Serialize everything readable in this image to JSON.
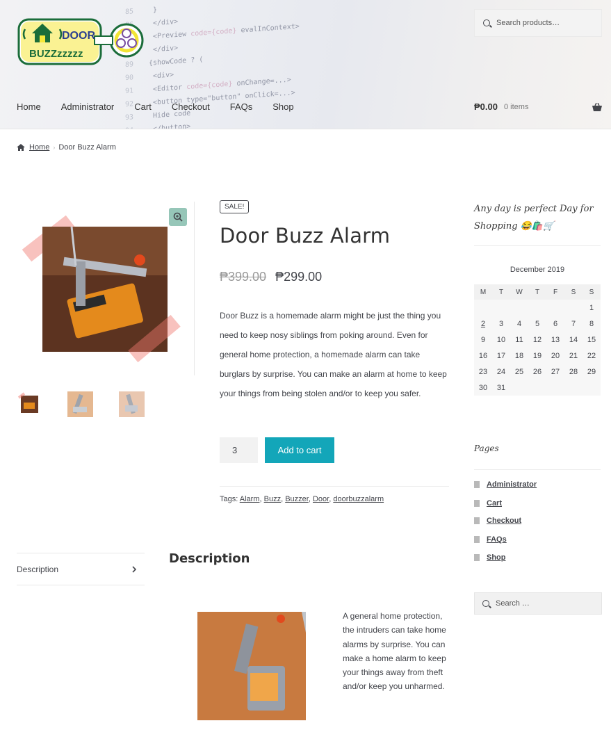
{
  "header": {
    "logo_text_1": "DOOR",
    "logo_text_2": "BUZZzzzzz",
    "search_placeholder": "Search products…",
    "nav": [
      "Home",
      "Administrator",
      "Cart",
      "Checkout",
      "FAQs",
      "Shop"
    ],
    "cart_amount": "₱0.00",
    "cart_items": "0 items"
  },
  "breadcrumb": {
    "home": "Home",
    "current": "Door Buzz Alarm"
  },
  "product": {
    "badge": "SALE!",
    "title": "Door Buzz Alarm",
    "old_price": "₱399.00",
    "new_price": "₱299.00",
    "description": "Door Buzz is a homemade alarm might be just the thing you need to keep nosy siblings from poking around. Even for general home protection, a homemade alarm can take burglars by surprise. You can make an alarm at home to keep your things from being stolen and/or to keep you safer.",
    "quantity": "3",
    "add_to_cart": "Add to cart",
    "tags_label": "Tags:",
    "tags": [
      "Alarm",
      "Buzz",
      "Buzzer",
      "Door",
      "doorbuzzalarm"
    ]
  },
  "tabs": {
    "items": [
      "Description"
    ],
    "heading": "Description",
    "body": "A general home protection, the intruders can take home alarms by surprise. You can make a home alarm to keep your things away from theft and/or keep you unharmed."
  },
  "sidebar": {
    "tagline": "Any day is perfect Day for Shopping 😂🛍️🛒",
    "calendar": {
      "caption": "December 2019",
      "weekdays": [
        "M",
        "T",
        "W",
        "T",
        "F",
        "S",
        "S"
      ],
      "weeks": [
        [
          "",
          "",
          "",
          "",
          "",
          "",
          "1"
        ],
        [
          "2",
          "3",
          "4",
          "5",
          "6",
          "7",
          "8"
        ],
        [
          "9",
          "10",
          "11",
          "12",
          "13",
          "14",
          "15"
        ],
        [
          "16",
          "17",
          "18",
          "19",
          "20",
          "21",
          "22"
        ],
        [
          "23",
          "24",
          "25",
          "26",
          "27",
          "28",
          "29"
        ],
        [
          "30",
          "31",
          "",
          "",
          "",
          "",
          ""
        ]
      ],
      "linked_day": "2"
    },
    "pages_title": "Pages",
    "pages": [
      "Administrator",
      "Cart",
      "Checkout",
      "FAQs",
      "Shop"
    ],
    "search_placeholder": "Search …"
  },
  "colors": {
    "accent": "#13a6b9",
    "zoom_button": "#96c6b8",
    "text": "#43454b"
  }
}
